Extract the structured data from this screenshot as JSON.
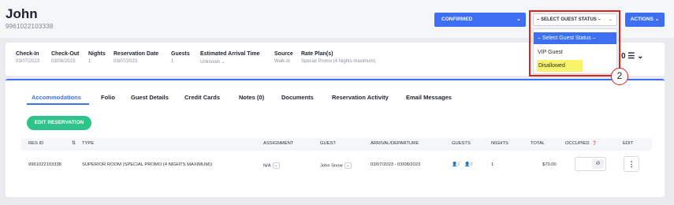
{
  "guest": {
    "name": "John",
    "phone": "9961022103338"
  },
  "status_button": {
    "label": "CONFIRMED",
    "chevron": "⌄"
  },
  "guest_status_select": {
    "value": "– SELECT GUEST STATUS –",
    "options": [
      "– Select Guest Status –",
      "VIP Guest",
      "Disallowed"
    ],
    "chevron": "⌄"
  },
  "actions_button": {
    "label": "ACTIONS ⌄"
  },
  "callout": {
    "number": "2"
  },
  "reservation_info": [
    {
      "label": "Check-In",
      "value": "03/07/2023"
    },
    {
      "label": "Check-Out",
      "value": "03/08/2023"
    },
    {
      "label": "Nights",
      "value": "1"
    },
    {
      "label": "Reservation Date",
      "value": "03/07/2023"
    },
    {
      "label": "Guests",
      "value": "1"
    },
    {
      "label": "Estimated Arrival Time",
      "value": "Unknown ⌄"
    },
    {
      "label": "Source",
      "value": "Walk-In"
    },
    {
      "label": "Rate Plan(s)",
      "value": "Special Promo (4 Nights maximum)"
    }
  ],
  "info_extra": "0 ☰ ⌄",
  "tabs": [
    "Accommodations",
    "Folio",
    "Guest Details",
    "Credit Cards",
    "Notes (0)",
    "Documents",
    "Reservation Activity",
    "Email Messages"
  ],
  "edit_reservation_label": "EDIT RESERVATION",
  "table": {
    "headers": [
      "RES ID",
      "TYPE",
      "ASSIGNMENT",
      "GUEST",
      "ARRIVAL/DEPARTURE",
      "GUESTS",
      "NIGHTS",
      "TOTAL",
      "OCCUPIED",
      "EDIT"
    ],
    "sort_icon": "⇅",
    "occupied_info_icon": "❓",
    "row": {
      "res_id": "9961022103338",
      "type": "SUPERIOR ROOM (SPECIAL PROMO (4 NIGHTS MAXIMUM))",
      "assignment": "N/A",
      "guest": "John Snow",
      "arrival_departure": "03/07/2023 - 03/08/2023",
      "guests_adults": "1",
      "guests_children": "0",
      "nights": "1",
      "total": "$70.00",
      "occupied_icon": "⊘",
      "edit_icon": "⋮"
    }
  },
  "colors": {
    "accent": "#3d6ff0",
    "success": "#2ec38a",
    "highlight": "#f7f36a",
    "annotation": "#e0211b"
  }
}
